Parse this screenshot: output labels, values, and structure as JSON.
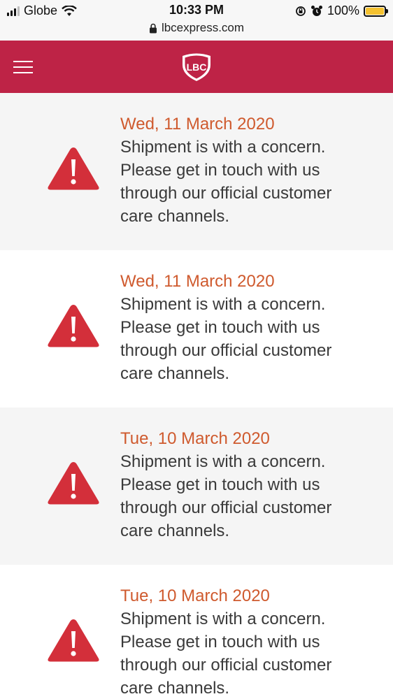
{
  "status_bar": {
    "carrier": "Globe",
    "time": "10:33 PM",
    "battery_percent": "100%"
  },
  "browser": {
    "url": "lbcexpress.com"
  },
  "header": {
    "brand_color": "#be2346",
    "logo_text": "LBC"
  },
  "colors": {
    "date": "#cf5a2e",
    "message": "#3a3a3a",
    "warning_icon": "#d32f3a"
  },
  "entries": [
    {
      "date": "Wed, 11 March 2020",
      "lines": [
        "Shipment is with a concern.",
        "Please get in touch with us",
        "through our official customer",
        "care channels."
      ]
    },
    {
      "date": "Wed, 11 March 2020",
      "lines": [
        "Shipment is with a concern.",
        "Please get in touch with us",
        "through our official customer",
        "care channels."
      ]
    },
    {
      "date": "Tue, 10 March 2020",
      "lines": [
        "Shipment is with a concern.",
        "Please get in touch with us",
        "through our official customer",
        "care channels."
      ]
    },
    {
      "date": "Tue, 10 March 2020",
      "lines": [
        "Shipment is with a concern.",
        "Please get in touch with us",
        "through our official customer",
        "care channels."
      ]
    }
  ]
}
